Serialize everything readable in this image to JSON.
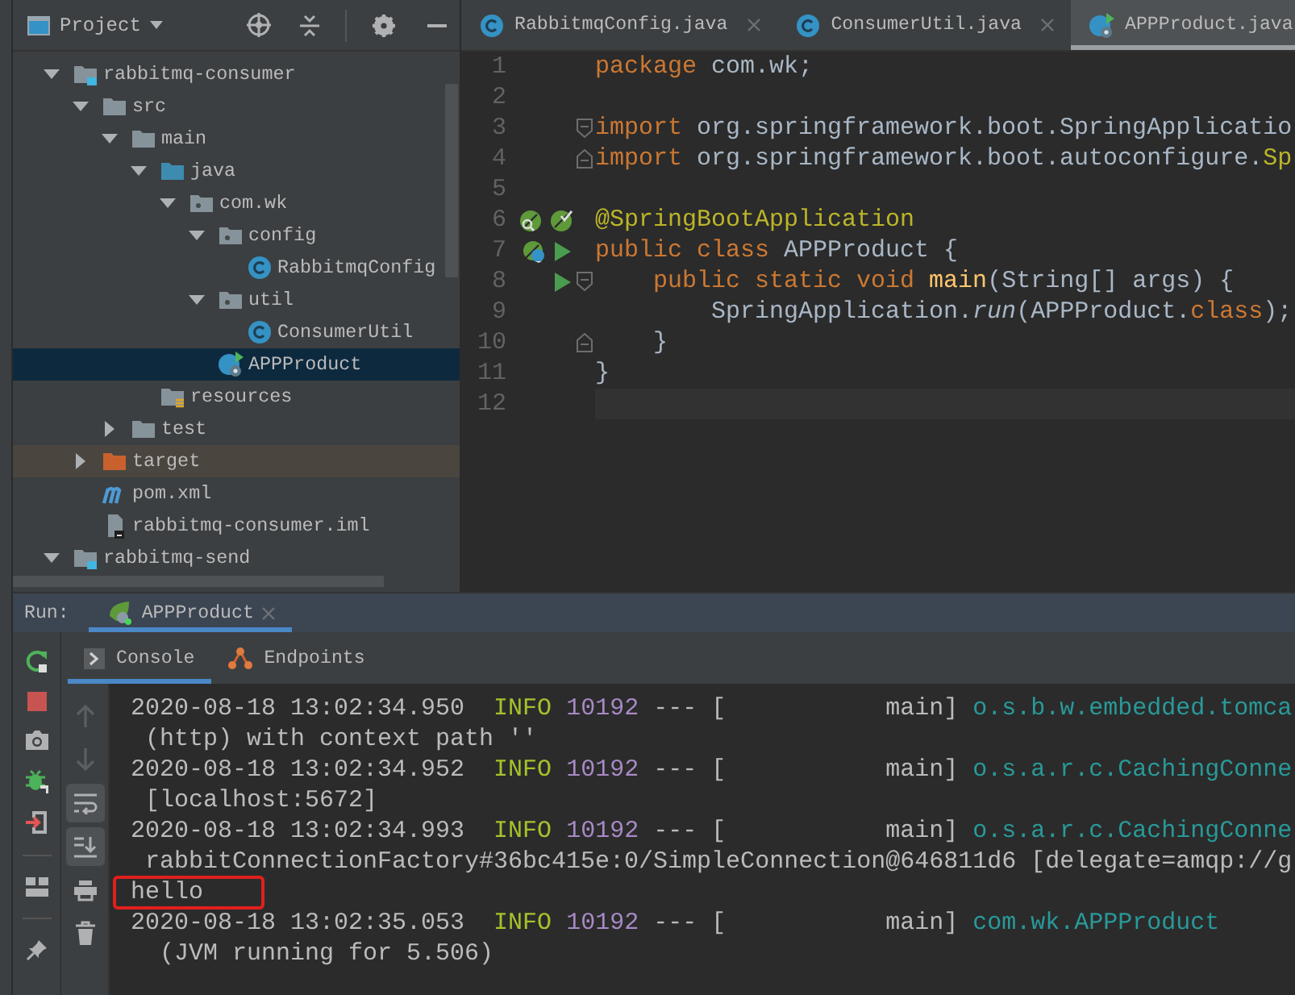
{
  "project": {
    "title": "Project",
    "tree": [
      {
        "label": "rabbitmq-consumer",
        "kind": "module",
        "expanded": true,
        "selected": false,
        "children": [
          {
            "label": "src",
            "kind": "folder",
            "expanded": true,
            "selected": false,
            "children": [
              {
                "label": "main",
                "kind": "folder",
                "expanded": true,
                "selected": false,
                "children": [
                  {
                    "label": "java",
                    "kind": "source-folder",
                    "expanded": true,
                    "selected": false,
                    "children": [
                      {
                        "label": "com.wk",
                        "kind": "package",
                        "expanded": true,
                        "selected": false,
                        "children": [
                          {
                            "label": "config",
                            "kind": "package",
                            "expanded": true,
                            "selected": false,
                            "children": [
                              {
                                "label": "RabbitmqConfig",
                                "kind": "class",
                                "selected": false
                              }
                            ]
                          },
                          {
                            "label": "util",
                            "kind": "package",
                            "expanded": true,
                            "selected": false,
                            "children": [
                              {
                                "label": "ConsumerUtil",
                                "kind": "class",
                                "selected": false
                              }
                            ]
                          },
                          {
                            "label": "APPProduct",
                            "kind": "spring-class",
                            "selected": true
                          }
                        ]
                      }
                    ]
                  },
                  {
                    "label": "resources",
                    "kind": "resources-folder",
                    "selected": false
                  }
                ]
              },
              {
                "label": "test",
                "kind": "folder",
                "expanded": false,
                "selected": false
              }
            ]
          },
          {
            "label": "target",
            "kind": "excluded-folder",
            "expanded": false,
            "selected": false
          },
          {
            "label": "pom.xml",
            "kind": "maven",
            "selected": false
          },
          {
            "label": "rabbitmq-consumer.iml",
            "kind": "iml",
            "selected": false
          }
        ]
      },
      {
        "label": "rabbitmq-send",
        "kind": "module",
        "expanded": true,
        "selected": false
      }
    ]
  },
  "editor": {
    "tabs": [
      {
        "label": "RabbitmqConfig.java",
        "kind": "class",
        "selected": false
      },
      {
        "label": "ConsumerUtil.java",
        "kind": "class",
        "selected": false
      },
      {
        "label": "APPProduct.java",
        "kind": "spring-class",
        "selected": true
      }
    ],
    "lines": [
      {
        "number": "1",
        "tokens": [
          {
            "kind": "keyword",
            "text": "package"
          },
          {
            "kind": "plain",
            "text": " com.wk;"
          }
        ]
      },
      {
        "number": "2"
      },
      {
        "number": "3",
        "fold": {
          "kind": "open"
        },
        "tokens": [
          {
            "kind": "keyword",
            "text": "import"
          },
          {
            "kind": "plain",
            "text": " org.springframework.boot.SpringApplicatio"
          }
        ]
      },
      {
        "number": "4",
        "fold": {
          "kind": "close"
        },
        "tokens": [
          {
            "kind": "keyword",
            "text": "import"
          },
          {
            "kind": "plain",
            "text": " org.springframework.boot.autoconfigure."
          },
          {
            "kind": "annotation",
            "text": "Sp"
          }
        ]
      },
      {
        "number": "5"
      },
      {
        "number": "6",
        "gutter": [
          {
            "kind": "leaf-search"
          },
          {
            "kind": "leaf-check"
          }
        ],
        "tokens": [
          {
            "kind": "annotation",
            "text": "@SpringBootApplication"
          }
        ]
      },
      {
        "number": "7",
        "gutter": [
          {
            "kind": "leaf-class"
          },
          {
            "kind": "run"
          }
        ],
        "tokens": [
          {
            "kind": "keyword",
            "text": "public class"
          },
          {
            "kind": "plain",
            "text": " APPProduct {"
          }
        ]
      },
      {
        "number": "8",
        "gutter": [
          {
            "kind": "run"
          }
        ],
        "fold": {
          "kind": "open"
        },
        "tokens": [
          {
            "kind": "keyword",
            "text": "    public static void"
          },
          {
            "kind": "method",
            "text": " main"
          },
          {
            "kind": "plain",
            "text": "(String[] args) {"
          }
        ]
      },
      {
        "number": "9",
        "tokens": [
          {
            "kind": "plain",
            "text": "        SpringApplication."
          },
          {
            "kind": "static-call",
            "text": "run"
          },
          {
            "kind": "plain",
            "text": "(APPProduct."
          },
          {
            "kind": "keyword",
            "text": "class"
          },
          {
            "kind": "plain",
            "text": ");"
          }
        ]
      },
      {
        "number": "10",
        "fold": {
          "kind": "close"
        },
        "tokens": [
          {
            "kind": "plain",
            "text": "    }"
          }
        ]
      },
      {
        "number": "11",
        "tokens": [
          {
            "kind": "plain",
            "text": "}"
          }
        ]
      },
      {
        "number": "12",
        "current": true
      }
    ]
  },
  "run": {
    "label": "Run:",
    "tabs": [
      {
        "label": "APPProduct",
        "selected": true
      }
    ],
    "views": [
      {
        "label": "Console",
        "kind": "console",
        "selected": true
      },
      {
        "label": "Endpoints",
        "kind": "endpoints",
        "selected": false
      }
    ],
    "side_tools": [
      {
        "kind": "rerun"
      },
      {
        "kind": "stop"
      },
      {
        "kind": "snapshot"
      },
      {
        "kind": "debug"
      },
      {
        "kind": "exit"
      },
      {
        "kind": "layout"
      },
      {
        "kind": "pin"
      }
    ],
    "console_tools": [
      {
        "kind": "up",
        "on": false,
        "disabled": true
      },
      {
        "kind": "down",
        "on": false,
        "disabled": true
      },
      {
        "kind": "wrap",
        "on": true,
        "disabled": false
      },
      {
        "kind": "scroll-end",
        "on": true,
        "disabled": false
      },
      {
        "kind": "print",
        "on": false,
        "disabled": false
      },
      {
        "kind": "clear",
        "on": false,
        "disabled": false
      }
    ],
    "lines": [
      {
        "highlighted": false,
        "segments": [
          {
            "kind": "text",
            "text": "2020-08-18 13:02:34.950  "
          },
          {
            "kind": "level",
            "text": "INFO"
          },
          {
            "kind": "pid",
            "text": " 10192"
          },
          {
            "kind": "text",
            "text": " --- [           main] "
          },
          {
            "kind": "logger",
            "text": "o.s.b.w.embedded.tomca"
          }
        ]
      },
      {
        "highlighted": false,
        "segments": [
          {
            "kind": "text",
            "text": " (http) with context path ''"
          }
        ]
      },
      {
        "highlighted": false,
        "segments": [
          {
            "kind": "text",
            "text": "2020-08-18 13:02:34.952  "
          },
          {
            "kind": "level",
            "text": "INFO"
          },
          {
            "kind": "pid",
            "text": " 10192"
          },
          {
            "kind": "text",
            "text": " --- [           main] "
          },
          {
            "kind": "logger",
            "text": "o.s.a.r.c.CachingConne"
          }
        ]
      },
      {
        "highlighted": false,
        "segments": [
          {
            "kind": "text",
            "text": " [localhost:5672]"
          }
        ]
      },
      {
        "highlighted": false,
        "segments": [
          {
            "kind": "text",
            "text": "2020-08-18 13:02:34.993  "
          },
          {
            "kind": "level",
            "text": "INFO"
          },
          {
            "kind": "pid",
            "text": " 10192"
          },
          {
            "kind": "text",
            "text": " --- [           main] "
          },
          {
            "kind": "logger",
            "text": "o.s.a.r.c.CachingConne"
          }
        ]
      },
      {
        "highlighted": false,
        "segments": [
          {
            "kind": "text",
            "text": " rabbitConnectionFactory#36bc415e:0/SimpleConnection@646811d6 [delegate=amqp://g"
          }
        ]
      },
      {
        "highlighted": true,
        "segments": [
          {
            "kind": "text",
            "text": "hello"
          }
        ]
      },
      {
        "highlighted": false,
        "segments": [
          {
            "kind": "text",
            "text": "2020-08-18 13:02:35.053  "
          },
          {
            "kind": "level",
            "text": "INFO"
          },
          {
            "kind": "pid",
            "text": " 10192"
          },
          {
            "kind": "text",
            "text": " --- [           main] "
          },
          {
            "kind": "logger",
            "text": "com.wk.APPProduct"
          }
        ]
      },
      {
        "highlighted": false,
        "segments": [
          {
            "kind": "text",
            "text": "  (JVM running for 5.506)"
          }
        ]
      }
    ]
  }
}
